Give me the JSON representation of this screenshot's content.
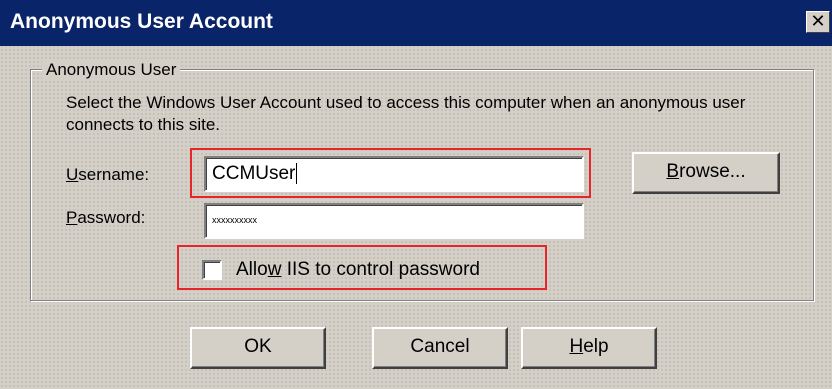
{
  "window": {
    "title": "Anonymous User Account",
    "close_glyph": "✕"
  },
  "group": {
    "title": "Anonymous User",
    "description": "Select the Windows User Account used to access this computer when an anonymous user connects to this site."
  },
  "username": {
    "label_prefix": "U",
    "label_rest": "sername:",
    "value": "CCMUser"
  },
  "password": {
    "label_prefix": "P",
    "label_rest": "assword:",
    "value": "xxxxxxxxxx"
  },
  "browse_button": {
    "label_prefix": "B",
    "label_rest": "rowse..."
  },
  "checkbox": {
    "label_before": "Allo",
    "label_accel": "w",
    "label_after": " IIS to control password",
    "checked": false
  },
  "buttons": {
    "ok": "OK",
    "cancel": "Cancel",
    "help_prefix": "H",
    "help_rest": "elp"
  },
  "colors": {
    "titlebar": "#0a246a",
    "dialog_face": "#d4d0c8",
    "highlight": "#e8262a"
  }
}
